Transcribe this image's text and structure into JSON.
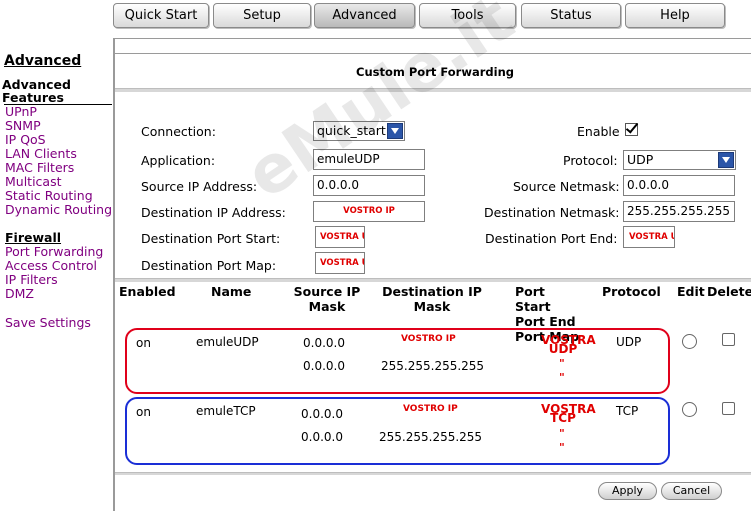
{
  "tabs": [
    {
      "label": "Quick Start",
      "active": false
    },
    {
      "label": "Setup",
      "active": false
    },
    {
      "label": "Advanced",
      "active": true
    },
    {
      "label": "Tools",
      "active": false
    },
    {
      "label": "Status",
      "active": false
    },
    {
      "label": "Help",
      "active": false
    }
  ],
  "sidebar": {
    "title": "Advanced",
    "section1": "Advanced Features",
    "links1": [
      "UPnP",
      "SNMP",
      "IP QoS",
      "LAN Clients",
      "MAC Filters",
      "Multicast",
      "Static Routing",
      "Dynamic Routing"
    ],
    "section2": "Firewall",
    "links2": [
      "Port Forwarding",
      "Access Control",
      "IP Filters",
      "DMZ"
    ],
    "save": "Save Settings"
  },
  "page_title": "Custom Port Forwarding",
  "form": {
    "connection_label": "Connection:",
    "connection_value": "quick_start",
    "enable_label": "Enable",
    "enable_checked": true,
    "application_label": "Application:",
    "application_value": "emuleUDP",
    "protocol_label": "Protocol:",
    "protocol_value": "UDP",
    "source_ip_label": "Source IP Address:",
    "source_ip_value": "0.0.0.0",
    "source_netmask_label": "Source Netmask:",
    "source_netmask_value": "0.0.0.0",
    "dest_ip_label": "Destination IP Address:",
    "dest_ip_value": "VOSTRO IP",
    "dest_netmask_label": "Destination Netmask:",
    "dest_netmask_value": "255.255.255.255",
    "dest_port_start_label": "Destination Port Start:",
    "dest_port_start_value": "VOSTRA UDP",
    "dest_port_end_label": "Destination Port End:",
    "dest_port_end_value": "VOSTRA UDP",
    "dest_port_map_label": "Destination Port Map:",
    "dest_port_map_value": "VOSTRA UDP"
  },
  "table": {
    "headers": {
      "enabled": "Enabled",
      "name": "Name",
      "source": "Source IP Mask",
      "destination": "Destination IP Mask",
      "ports": "Port Start Port End Port Map",
      "protocol": "Protocol",
      "edit": "Edit",
      "delete": "Delete"
    },
    "rows": [
      {
        "enabled": "on",
        "name": "emuleUDP",
        "source_ip": "0.0.0.0",
        "source_mask": "0.0.0.0",
        "dest_ip": "VOSTRO IP",
        "dest_mask": "255.255.255.255",
        "port": "VOSTRA UDP",
        "ditto1": "\"",
        "ditto2": "\"",
        "protocol": "UDP"
      },
      {
        "enabled": "on",
        "name": "emuleTCP",
        "source_ip": "0.0.0.0",
        "source_mask": "0.0.0.0",
        "dest_ip": "VOSTRO IP",
        "dest_mask": "255.255.255.255",
        "port": "VOSTRA TCP",
        "ditto1": "\"",
        "ditto2": "\"",
        "protocol": "TCP"
      }
    ]
  },
  "buttons": {
    "apply": "Apply",
    "cancel": "Cancel"
  },
  "watermark": "eMule.it",
  "colors": {
    "row1_outline": "#e0001a",
    "row2_outline": "#1a2ed6",
    "link": "#800080",
    "annotation": "#e00000"
  }
}
